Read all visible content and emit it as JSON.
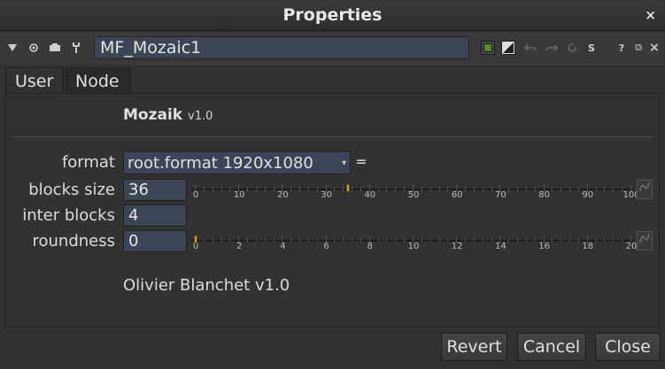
{
  "window": {
    "title": "Properties",
    "close_glyph": "×"
  },
  "toolbar": {
    "node_name": "MF_Mozaic1",
    "left_icons": [
      "collapse-arrow-icon",
      "center-node-icon",
      "float-panel-icon",
      "node-settings-icon"
    ],
    "right_icons": [
      "node-color-icon",
      "gl-color-icon",
      "undo-icon",
      "redo-icon",
      "revert-icon",
      "script-icon",
      "help-icon",
      "float-icon",
      "close-panel-icon"
    ],
    "help_glyph": "?",
    "float_glyph": "⧉",
    "close_glyph": "×",
    "script_glyph": "S",
    "accent_green": "#5a8a2a"
  },
  "tabs": {
    "user_label": "User",
    "node_label": "Node"
  },
  "plugin": {
    "name": "Mozaik",
    "version": "v1.0"
  },
  "knobs": {
    "format": {
      "label": "format",
      "value": "root.format 1920x1080",
      "arrow": "▾",
      "eq_glyph": "="
    },
    "blocks_size": {
      "label": "blocks size",
      "value": "36",
      "slider": {
        "min": 0,
        "max": 100,
        "value": 35,
        "tick_labels": [
          "0",
          "10",
          "20",
          "30",
          "40",
          "50",
          "60",
          "70",
          "80",
          "90",
          "100"
        ]
      }
    },
    "inter_blocks": {
      "label": "inter blocks",
      "value": "4"
    },
    "roundness": {
      "label": "roundness",
      "value": "0",
      "slider": {
        "min": 0,
        "max": 20,
        "value": 0,
        "tick_labels": [
          "0",
          "2",
          "4",
          "6",
          "8",
          "10",
          "12",
          "14",
          "16",
          "18",
          "20"
        ]
      }
    }
  },
  "credit": "Olivier Blanchet v1.0",
  "footer": {
    "revert_label": "Revert",
    "cancel_label": "Cancel",
    "close_label": "Close"
  },
  "colors": {
    "field_bg": "#3d4456",
    "handle": "#c7a23e",
    "panel_bg": "#323232"
  }
}
